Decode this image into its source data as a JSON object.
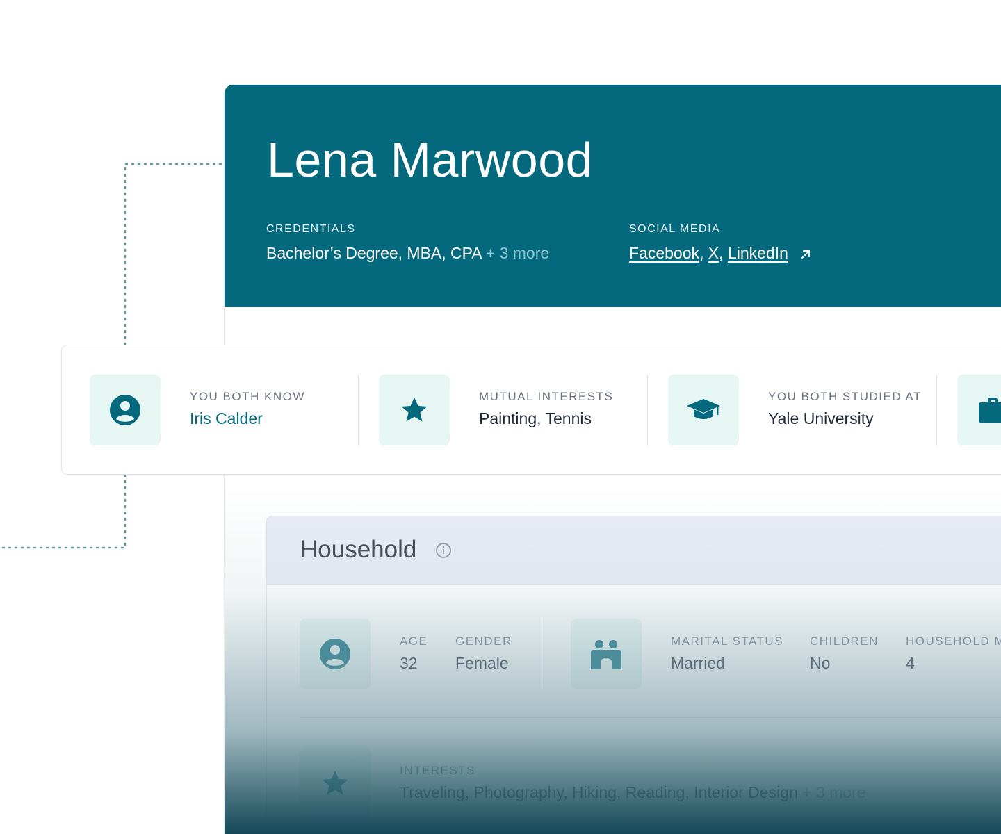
{
  "profile": {
    "name": "Lena Marwood",
    "credentials_label": "CREDENTIALS",
    "credentials_value": "Bachelor’s Degree, MBA, CPA",
    "credentials_more": "+ 3 more",
    "social_label": "SOCIAL MEDIA",
    "social_links": [
      "Facebook",
      "X",
      "LinkedIn"
    ],
    "social_sep": ","
  },
  "shared": {
    "items": [
      {
        "label": "YOU BOTH KNOW",
        "value": "Iris Calder",
        "icon": "person-icon"
      },
      {
        "label": "MUTUAL INTERESTS",
        "value": "Painting, Tennis",
        "icon": "star-icon"
      },
      {
        "label": "YOU BOTH STUDIED AT",
        "value": "Yale University",
        "icon": "graduation-cap-icon"
      },
      {
        "icon": "briefcase-icon"
      }
    ]
  },
  "household": {
    "title": "Household",
    "age_label": "AGE",
    "age_value": "32",
    "gender_label": "GENDER",
    "gender_value": "Female",
    "marital_label": "MARITAL STATUS",
    "marital_value": "Married",
    "children_label": "CHILDREN",
    "children_value": "No",
    "members_label": "HOUSEHOLD M",
    "members_value": "4",
    "interests_label": "INTERESTS",
    "interests_value": "Traveling, Photography, Hiking, Reading, Interior Design",
    "interests_more": "+ 3 more"
  },
  "colors": {
    "brand": "#05697d",
    "tile_bg": "#e6f6f3",
    "household_head_bg": "#e8ecf5",
    "more_muted": "#8fc6d0"
  }
}
